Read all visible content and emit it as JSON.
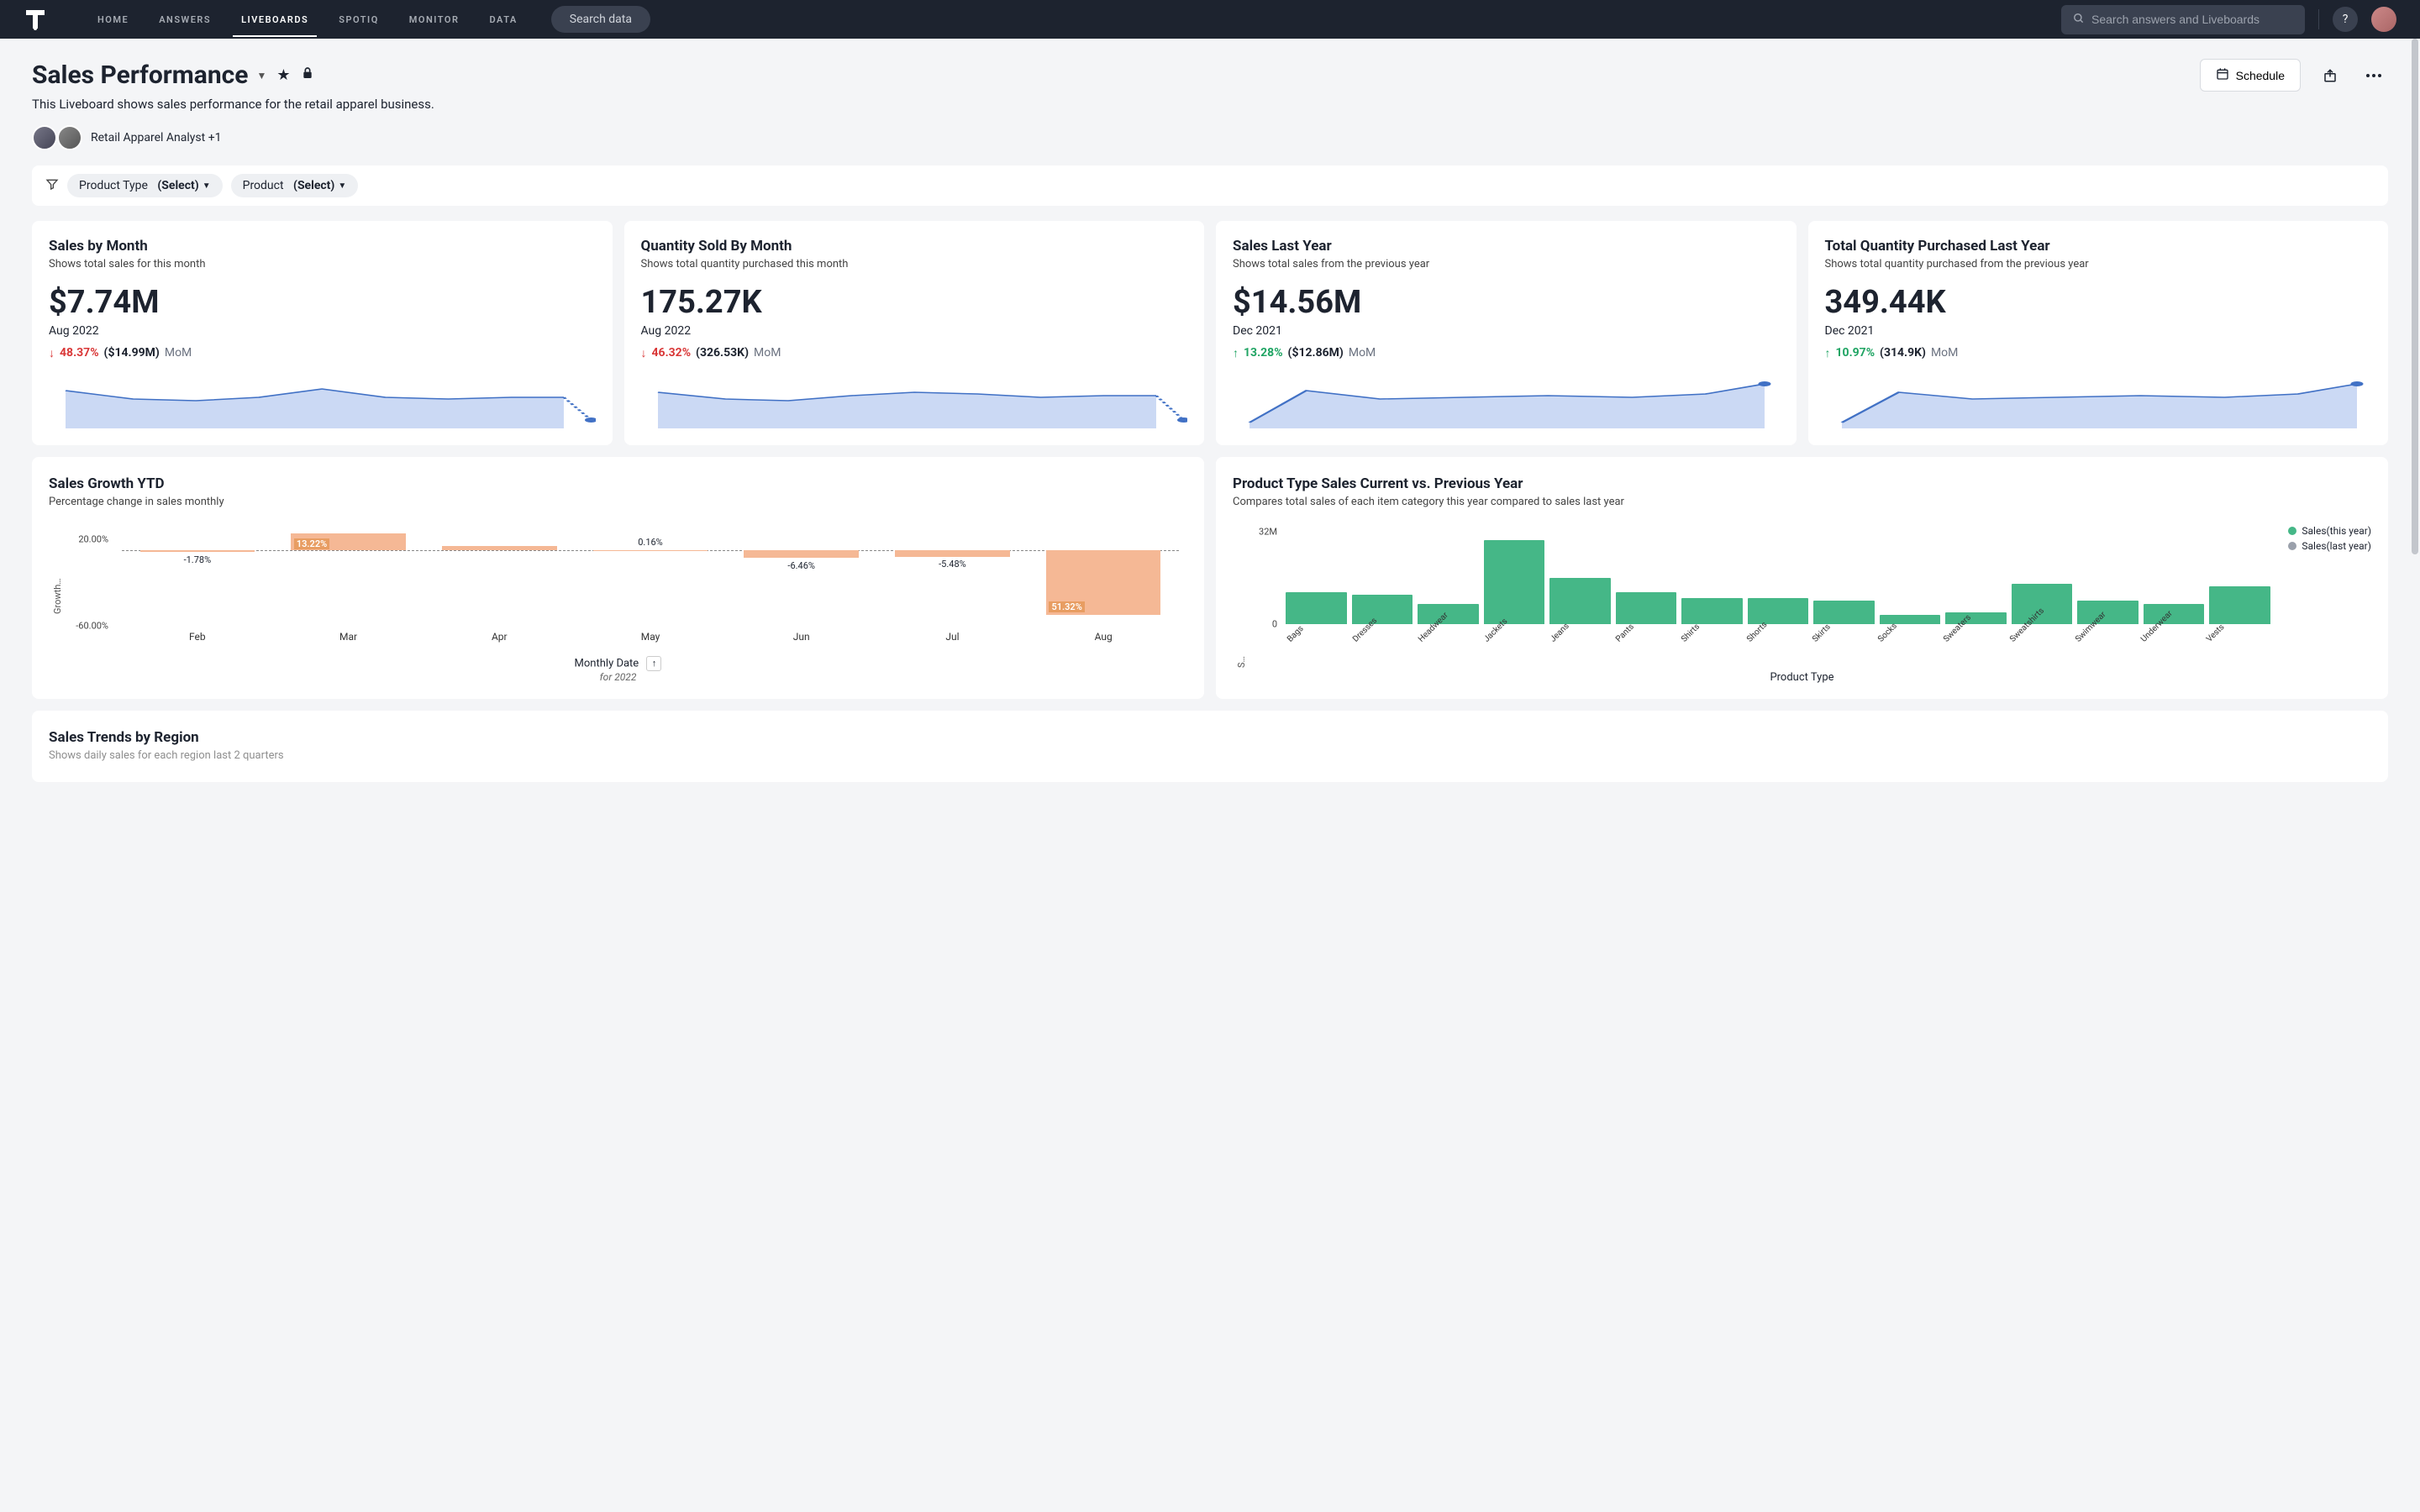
{
  "nav": {
    "items": [
      "HOME",
      "ANSWERS",
      "LIVEBOARDS",
      "SPOTIQ",
      "MONITOR",
      "DATA"
    ],
    "active_index": 2,
    "search_pill": "Search data",
    "search_placeholder": "Search answers and Liveboards",
    "help_label": "?"
  },
  "header": {
    "title": "Sales Performance",
    "subtitle": "This Liveboard shows sales performance for the retail apparel business.",
    "authors_text": "Retail Apparel Analyst +1",
    "schedule_label": "Schedule"
  },
  "filters": {
    "chips": [
      {
        "label": "Product Type",
        "value": "(Select)"
      },
      {
        "label": "Product",
        "value": "(Select)"
      }
    ]
  },
  "kpis": [
    {
      "title": "Sales by Month",
      "sub": "Shows total sales for this month",
      "value": "$7.74M",
      "period": "Aug 2022",
      "dir": "neg",
      "pct": "48.37%",
      "paren": "($14.99M)",
      "mom": "MoM"
    },
    {
      "title": "Quantity Sold By Month",
      "sub": "Shows total quantity purchased this month",
      "value": "175.27K",
      "period": "Aug 2022",
      "dir": "neg",
      "pct": "46.32%",
      "paren": "(326.53K)",
      "mom": "MoM"
    },
    {
      "title": "Sales Last Year",
      "sub": "Shows total sales from the previous year",
      "value": "$14.56M",
      "period": "Dec 2021",
      "dir": "pos",
      "pct": "13.28%",
      "paren": "($12.86M)",
      "mom": "MoM"
    },
    {
      "title": "Total Quantity Purchased Last Year",
      "sub": "Shows total quantity purchased from the previous year",
      "value": "349.44K",
      "period": "Dec 2021",
      "dir": "pos",
      "pct": "10.97%",
      "paren": "(314.9K)",
      "mom": "MoM"
    }
  ],
  "growth": {
    "title": "Sales Growth YTD",
    "sub": "Percentage change in sales monthly",
    "ylabel": "Growth…",
    "y_ticks": [
      "20.00%",
      "-60.00%"
    ],
    "footer_label": "Monthly Date",
    "footer_for": "for 2022"
  },
  "product": {
    "title": "Product Type Sales Current vs. Previous Year",
    "sub": "Compares total sales of each item category this year compared to sales last year",
    "ylabel": "S…",
    "xlabel": "Product Type",
    "y_ticks": [
      "32M",
      "0"
    ],
    "legend": [
      "Sales(this year)",
      "Sales(last year)"
    ],
    "legend_colors": [
      "#45b787",
      "#9aa0ab"
    ]
  },
  "region": {
    "title": "Sales Trends by Region",
    "sub": "Shows daily sales for each region last 2 quarters"
  },
  "chart_data": [
    {
      "id": "sales_growth_ytd",
      "type": "bar",
      "title": "Sales Growth YTD",
      "xlabel": "Monthly Date",
      "ylabel": "Growth %",
      "ylim": [
        -60,
        20
      ],
      "categories": [
        "Feb",
        "Mar",
        "Apr",
        "May",
        "Jun",
        "Jul",
        "Aug"
      ],
      "values": [
        -1.78,
        13.22,
        3.0,
        0.16,
        -6.46,
        -5.48,
        -51.32
      ],
      "value_labels": [
        "-1.78%",
        "13.22%",
        "",
        "0.16%",
        "-6.46%",
        "-5.48%",
        "51.32%"
      ]
    },
    {
      "id": "product_type_sales",
      "type": "bar",
      "title": "Product Type Sales Current vs. Previous Year",
      "xlabel": "Product Type",
      "ylabel": "Sales",
      "ylim": [
        0,
        32
      ],
      "categories": [
        "Bags",
        "Dresses",
        "Headwear",
        "Jackets",
        "Jeans",
        "Pants",
        "Shirts",
        "Shorts",
        "Skirts",
        "Socks",
        "Sweaters",
        "Sweatshirts",
        "Swimwear",
        "Underwear",
        "Vests"
      ],
      "series": [
        {
          "name": "Sales(this year)",
          "values": [
            11,
            10,
            7,
            29,
            16,
            11,
            9,
            9,
            8,
            3,
            4,
            14,
            8,
            7,
            13
          ]
        }
      ]
    }
  ]
}
